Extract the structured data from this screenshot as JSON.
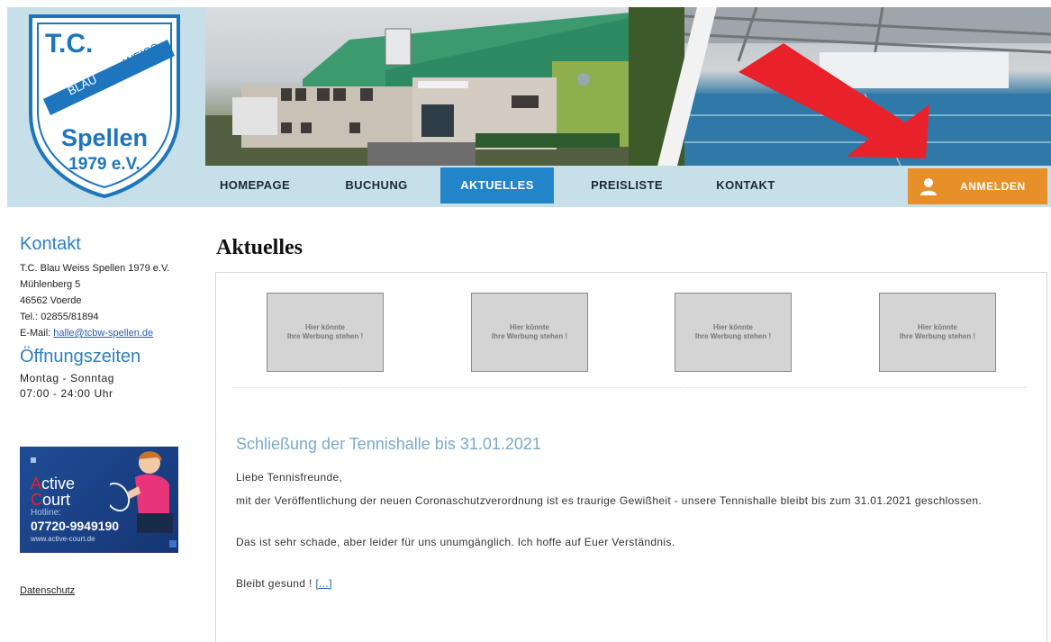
{
  "logo": {
    "line1": "T.C.",
    "band1": "BLAU",
    "band2": "WEISS",
    "name": "Spellen",
    "year": "1979 e.V."
  },
  "nav": {
    "items": [
      {
        "label": "HOMEPAGE"
      },
      {
        "label": "BUCHUNG"
      },
      {
        "label": "AKTUELLES",
        "active": true
      },
      {
        "label": "PREISLISTE"
      },
      {
        "label": "KONTAKT"
      }
    ],
    "login_label": "ANMELDEN"
  },
  "colors": {
    "accent": "#2385c9",
    "login": "#e7902a",
    "nav_bg": "#c6dfe8",
    "heading": "#2d7fc0",
    "post_title": "#7aa9cc"
  },
  "sidebar": {
    "contact_heading": "Kontakt",
    "contact_lines": [
      "T.C. Blau Weiss Spellen 1979 e.V.",
      "Mühlenberg 5",
      "46562 Voerde",
      "Tel.: 02855/81894"
    ],
    "email_label": "E-Mail:",
    "email": "halle@tcbw-spellen.de",
    "hours_heading": "Öffnungszeiten",
    "hours_days": "Montag - Sonntag",
    "hours_time": "07:00 - 24:00 Uhr",
    "ad": {
      "name_red1": "A",
      "name_rest1": "ctive",
      "name_red2": "C",
      "name_rest2": "ourt",
      "hotline_label": "Hotline:",
      "phone": "07720-9949190",
      "url": "www.active-court.de"
    },
    "privacy": "Datenschutz"
  },
  "main": {
    "title": "Aktuelles",
    "ad_slot_line1": "Hier könnte",
    "ad_slot_line2": "Ihre Werbung stehen !",
    "post": {
      "title": "Schließung der Tennishalle bis 31.01.2021",
      "greeting": "Liebe Tennisfreunde,",
      "paragraph1": "mit der Veröffentlichung der neuen Coronaschutzverordnung ist es traurige Gewißheit - unsere Tennishalle bleibt bis zum 31.01.2021 geschlossen.",
      "paragraph2": "Das ist sehr schade, aber leider für uns unumgänglich. Ich hoffe auf Euer Verständnis.",
      "closing": "Bleibt gesund !",
      "read_more": "[...]"
    }
  }
}
